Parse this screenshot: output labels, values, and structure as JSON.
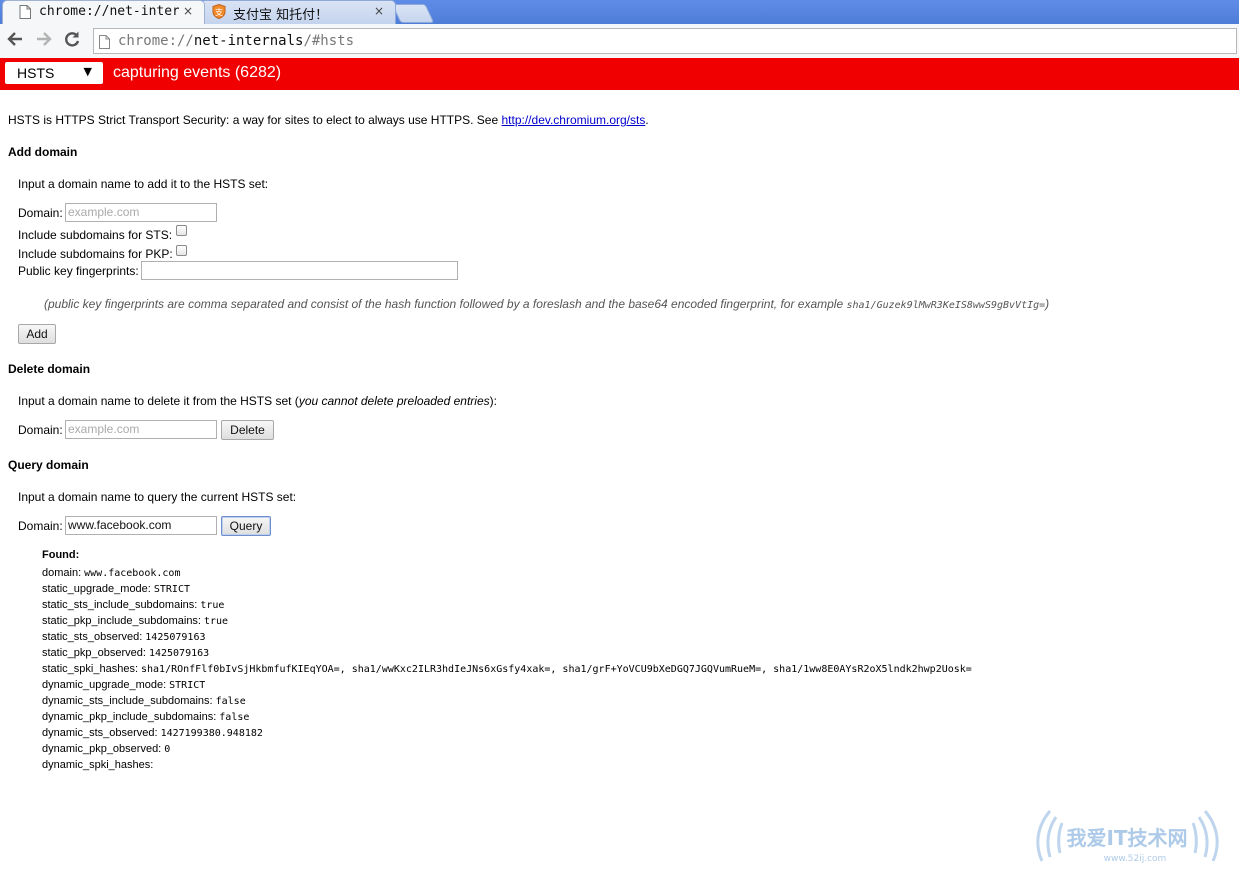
{
  "browser": {
    "tabs": [
      {
        "title": "chrome://net-internals",
        "close": "×",
        "active": true
      },
      {
        "title": "支付宝 知托付！",
        "close": "×",
        "active": false
      }
    ],
    "url_prefix": "chrome://",
    "url_host": "net-internals",
    "url_suffix": "/#hsts",
    "icons": {
      "back": "arrow-left",
      "forward": "arrow-right",
      "reload": "reload",
      "page": "page-icon"
    }
  },
  "statusbar": {
    "tab_select_value": "HSTS",
    "dropdown_arrow": "▼",
    "capturing_text": "capturing events (6282)",
    "color": "#f00000"
  },
  "intro": {
    "text": "HSTS is HTTPS Strict Transport Security: a way for sites to elect to always use HTTPS. See ",
    "link": "http://dev.chromium.org/sts",
    "after": "."
  },
  "add": {
    "heading": "Add domain",
    "desc": "Input a domain name to add it to the HSTS set:",
    "domain_label": "Domain:",
    "domain_placeholder": "example.com",
    "sts_label": "Include subdomains for STS:",
    "pkp_label": "Include subdomains for PKP:",
    "fingerprints_label": "Public key fingerprints:",
    "note": "(public key fingerprints are comma separated and consist of the hash function followed by a foreslash and the base64 encoded fingerprint, for example ",
    "note_example": "sha1/Guzek9lMwR3KeIS8wwS9gBvVtIg=",
    "note_end": ")",
    "button": "Add"
  },
  "delete": {
    "heading": "Delete domain",
    "desc_pre": "Input a domain name to delete it from the HSTS set (",
    "desc_italic": "you cannot delete preloaded entries",
    "desc_post": "):",
    "domain_label": "Domain:",
    "domain_placeholder": "example.com",
    "button": "Delete"
  },
  "query": {
    "heading": "Query domain",
    "desc": "Input a domain name to query the current HSTS set:",
    "domain_label": "Domain:",
    "domain_value": "www.facebook.com",
    "button": "Query"
  },
  "result": {
    "found": "Found:",
    "rows": [
      {
        "key": "domain:",
        "value": "www.facebook.com"
      },
      {
        "key": "static_upgrade_mode:",
        "value": "STRICT"
      },
      {
        "key": "static_sts_include_subdomains:",
        "value": "true"
      },
      {
        "key": "static_pkp_include_subdomains:",
        "value": "true"
      },
      {
        "key": "static_sts_observed:",
        "value": "1425079163"
      },
      {
        "key": "static_pkp_observed:",
        "value": "1425079163"
      },
      {
        "key": "static_spki_hashes:",
        "value": "sha1/ROnfFlf0bIvSjHkbmfufKIEqYOA=, sha1/wwKxc2ILR3hdIeJNs6xGsfy4xak=, sha1/grF+YoVCU9bXeDGQ7JGQVumRueM=, sha1/1ww8E0AYsR2oX5lndk2hwp2Uosk="
      },
      {
        "key": "dynamic_upgrade_mode:",
        "value": "STRICT"
      },
      {
        "key": "dynamic_sts_include_subdomains:",
        "value": "false"
      },
      {
        "key": "dynamic_pkp_include_subdomains:",
        "value": "false"
      },
      {
        "key": "dynamic_sts_observed:",
        "value": "1427199380.948182"
      },
      {
        "key": "dynamic_pkp_observed:",
        "value": "0"
      },
      {
        "key": "dynamic_spki_hashes:",
        "value": ""
      }
    ]
  },
  "watermark": {
    "text": "我爱IT技术网",
    "url": "www.52ij.com"
  }
}
